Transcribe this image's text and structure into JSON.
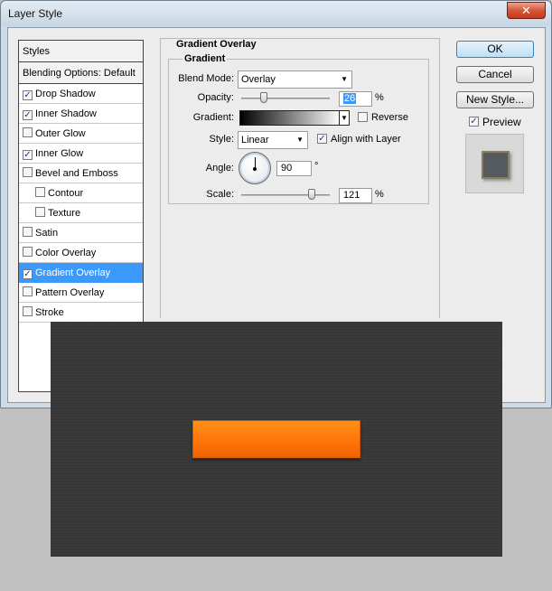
{
  "window": {
    "title": "Layer Style",
    "close_glyph": "✕"
  },
  "styles_list": {
    "header": "Styles",
    "blending": "Blending Options: Default",
    "items": [
      {
        "label": "Drop Shadow",
        "checked": true
      },
      {
        "label": "Inner Shadow",
        "checked": true
      },
      {
        "label": "Outer Glow",
        "checked": false
      },
      {
        "label": "Inner Glow",
        "checked": true
      },
      {
        "label": "Bevel and Emboss",
        "checked": false
      },
      {
        "label": "Contour",
        "checked": false
      },
      {
        "label": "Texture",
        "checked": false
      },
      {
        "label": "Satin",
        "checked": false
      },
      {
        "label": "Color Overlay",
        "checked": false
      },
      {
        "label": "Gradient Overlay",
        "checked": true
      },
      {
        "label": "Pattern Overlay",
        "checked": false
      },
      {
        "label": "Stroke",
        "checked": false
      }
    ]
  },
  "panel": {
    "group_title": "Gradient Overlay",
    "inner_title": "Gradient",
    "blend_mode": {
      "label": "Blend Mode:",
      "value": "Overlay"
    },
    "opacity": {
      "label": "Opacity:",
      "value": "26",
      "unit": "%",
      "level": 26
    },
    "gradient": {
      "label": "Gradient:",
      "reverse_label": "Reverse",
      "reverse_checked": false
    },
    "style": {
      "label": "Style:",
      "value": "Linear",
      "align_label": "Align with Layer",
      "align_checked": true
    },
    "angle": {
      "label": "Angle:",
      "value": "90",
      "unit": "°"
    },
    "scale": {
      "label": "Scale:",
      "value": "121",
      "unit": "%",
      "level": 121
    }
  },
  "buttons": {
    "ok": "OK",
    "cancel": "Cancel",
    "new_style": "New Style...",
    "preview_label": "Preview",
    "preview_checked": true
  },
  "check_glyph": "✓",
  "dropdown_glyph": "▼"
}
